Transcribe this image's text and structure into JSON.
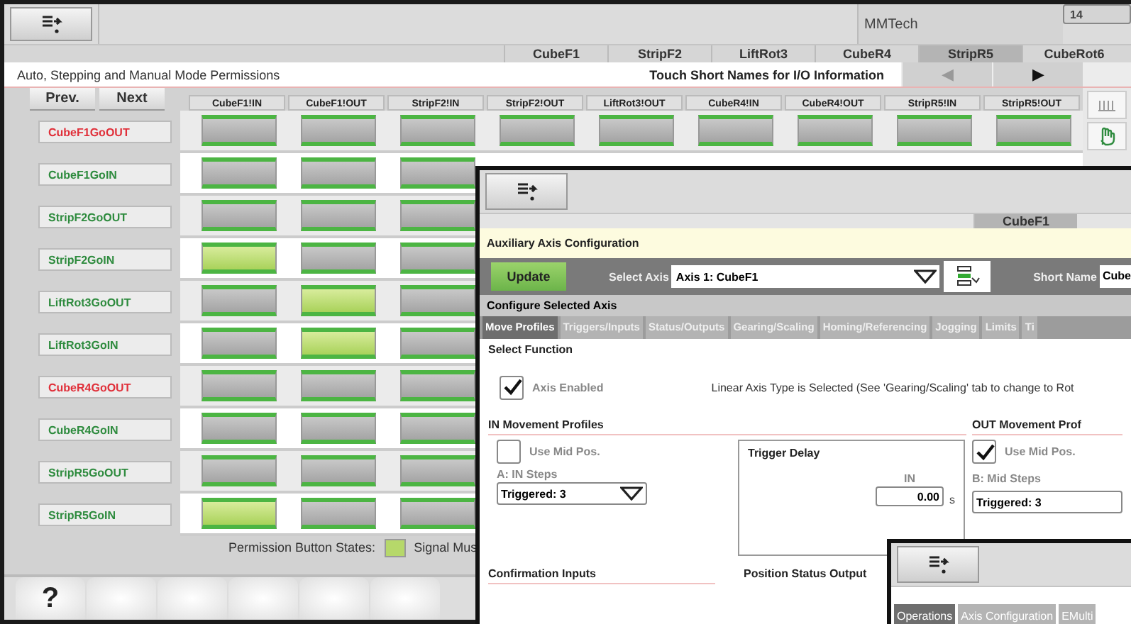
{
  "main_window": {
    "company": "MMTech",
    "number": "14",
    "station_tabs": [
      {
        "label": "CubeF1",
        "selected": false
      },
      {
        "label": "StripF2",
        "selected": false
      },
      {
        "label": "LiftRot3",
        "selected": false
      },
      {
        "label": "CubeR4",
        "selected": false
      },
      {
        "label": "StripR5",
        "selected": true
      },
      {
        "label": "CubeRot6",
        "selected": false
      }
    ],
    "title": "Auto, Stepping and Manual Mode Permissions",
    "hint": "Touch Short Names for I/O Information",
    "nav": [
      "◀",
      "▶"
    ],
    "prev_button": "Prev.",
    "next_button": "Next",
    "columns": [
      "CubeF1!IN",
      "CubeF1!OUT",
      "StripF2!IN",
      "StripF2!OUT",
      "LiftRot3!OUT",
      "CubeR4!IN",
      "CubeR4!OUT",
      "StripR5!IN",
      "StripR5!OUT"
    ],
    "rows": [
      {
        "label": "CubeF1GoOUT",
        "color": "#e0303a",
        "cells": [
          {
            "on": false
          },
          {
            "on": false
          },
          {
            "on": false
          },
          {
            "on": false
          },
          {
            "on": false
          },
          {
            "on": false
          },
          {
            "on": false
          },
          {
            "on": false
          },
          {
            "on": false
          }
        ]
      },
      {
        "label": "CubeF1GoIN",
        "color": "#2e8b3e",
        "cells": [
          {
            "on": false
          },
          {
            "on": false
          },
          {
            "on": false
          }
        ]
      },
      {
        "label": "StripF2GoOUT",
        "color": "#2e8b3e",
        "cells": [
          {
            "on": false
          },
          {
            "on": false
          },
          {
            "on": false
          }
        ]
      },
      {
        "label": "StripF2GoIN",
        "color": "#2e8b3e",
        "cells": [
          {
            "on": true
          },
          {
            "on": false
          },
          {
            "on": false
          }
        ]
      },
      {
        "label": "LiftRot3GoOUT",
        "color": "#2e8b3e",
        "cells": [
          {
            "on": false
          },
          {
            "on": true
          },
          {
            "on": false
          }
        ]
      },
      {
        "label": "LiftRot3GoIN",
        "color": "#2e8b3e",
        "cells": [
          {
            "on": false
          },
          {
            "on": true
          },
          {
            "on": false
          }
        ]
      },
      {
        "label": "CubeR4GoOUT",
        "color": "#e0303a",
        "cells": [
          {
            "on": false
          },
          {
            "on": false
          },
          {
            "on": false
          }
        ]
      },
      {
        "label": "CubeR4GoIN",
        "color": "#2e8b3e",
        "cells": [
          {
            "on": false
          },
          {
            "on": false
          },
          {
            "on": false
          }
        ]
      },
      {
        "label": "StripR5GoOUT",
        "color": "#2e8b3e",
        "cells": [
          {
            "on": false
          },
          {
            "on": false
          },
          {
            "on": false
          }
        ]
      },
      {
        "label": "StripR5GoIN",
        "color": "#2e8b3e",
        "cells": [
          {
            "on": true
          },
          {
            "on": false
          },
          {
            "on": false
          }
        ]
      }
    ],
    "legend_label": "Permission Button States:",
    "legend_item": "Signal Mus",
    "help_button": "?"
  },
  "axis_window": {
    "station_tab": "CubeF1",
    "title": "Auxiliary Axis Configuration",
    "update_button": "Update",
    "select_axis_label": "Select Axis",
    "axis_value": "Axis 1: CubeF1",
    "short_name_label": "Short Name",
    "short_name_value": "Cube",
    "section": "Configure Selected Axis",
    "tabs": [
      {
        "label": "Move Profiles",
        "selected": true
      },
      {
        "label": "Triggers/Inputs",
        "selected": false
      },
      {
        "label": "Status/Outputs",
        "selected": false
      },
      {
        "label": "Gearing/Scaling",
        "selected": false
      },
      {
        "label": "Homing/Referencing",
        "selected": false
      },
      {
        "label": "Jogging",
        "selected": false
      },
      {
        "label": "Limits",
        "selected": false
      },
      {
        "label": "Ti",
        "selected": false
      }
    ],
    "select_function": "Select Function",
    "axis_enabled": {
      "label": "Axis Enabled",
      "checked": true
    },
    "axis_type_note": "Linear Axis Type is Selected (See 'Gearing/Scaling' tab to change to Rot",
    "in_profiles": {
      "title": "IN Movement Profiles",
      "use_mid": {
        "label": "Use Mid Pos.",
        "checked": false
      },
      "steps_label": "A: IN Steps",
      "steps_value": "Triggered: 3"
    },
    "trigger_delay": {
      "title": "Trigger Delay",
      "column": "IN",
      "value": "0.00",
      "unit": "s"
    },
    "out_profiles": {
      "title": "OUT Movement Prof",
      "use_mid": {
        "label": "Use Mid Pos.",
        "checked": true
      },
      "steps_label": "B: Mid Steps",
      "steps_value": "Triggered: 3"
    },
    "confirmation_inputs": "Confirmation Inputs",
    "position_status": "Position Status Output"
  },
  "ops_window": {
    "tabs": [
      {
        "label": "Operations",
        "selected": true
      },
      {
        "label": "Axis Configuration",
        "selected": false
      },
      {
        "label": "EMulti",
        "selected": false
      }
    ]
  }
}
